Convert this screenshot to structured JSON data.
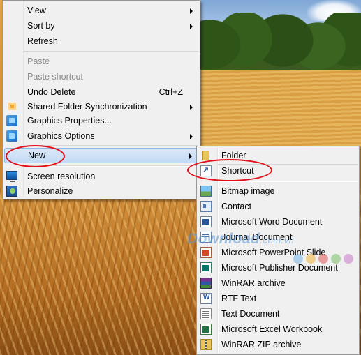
{
  "desktop_menu": {
    "items": [
      {
        "label": "View",
        "submenu": true
      },
      {
        "label": "Sort by",
        "submenu": true
      },
      {
        "label": "Refresh"
      },
      {
        "label": "Paste",
        "disabled": true
      },
      {
        "label": "Paste shortcut",
        "disabled": true
      },
      {
        "label": "Undo Delete",
        "shortcut": "Ctrl+Z"
      },
      {
        "label": "Shared Folder Synchronization",
        "icon": "sync-icon",
        "submenu": true
      },
      {
        "label": "Graphics Properties...",
        "icon": "graphics-icon"
      },
      {
        "label": "Graphics Options",
        "icon": "graphics-icon",
        "submenu": true
      },
      {
        "label": "New",
        "submenu": true,
        "highlighted": true
      },
      {
        "label": "Screen resolution",
        "icon": "monitor-icon"
      },
      {
        "label": "Personalize",
        "icon": "personalize-icon"
      }
    ]
  },
  "new_submenu": {
    "items": [
      {
        "label": "Folder",
        "icon": "folder-icon"
      },
      {
        "label": "Shortcut",
        "icon": "shortcut-icon"
      },
      {
        "label": "Bitmap image",
        "icon": "bitmap-icon"
      },
      {
        "label": "Contact",
        "icon": "contact-icon"
      },
      {
        "label": "Microsoft Word Document",
        "icon": "word-icon"
      },
      {
        "label": "Journal Document",
        "icon": "journal-icon"
      },
      {
        "label": "Microsoft PowerPoint Slide",
        "icon": "powerpoint-icon"
      },
      {
        "label": "Microsoft Publisher Document",
        "icon": "publisher-icon"
      },
      {
        "label": "WinRAR archive",
        "icon": "winrar-icon"
      },
      {
        "label": "RTF Text",
        "icon": "rtf-icon"
      },
      {
        "label": "Text Document",
        "icon": "text-icon"
      },
      {
        "label": "Microsoft Excel Workbook",
        "icon": "excel-icon"
      },
      {
        "label": "WinRAR ZIP archive",
        "icon": "zip-icon"
      }
    ]
  },
  "watermark": {
    "name": "Download",
    "tld": ".com.vn"
  },
  "colors": {
    "highlight": "#c3dbf5",
    "annotation": "#e3101b"
  }
}
